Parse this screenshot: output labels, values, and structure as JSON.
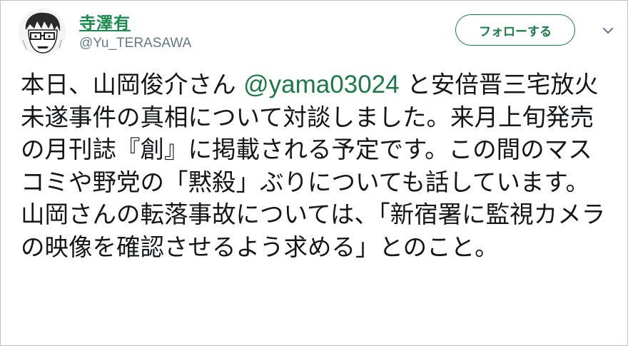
{
  "user": {
    "display_name": "寺澤有",
    "handle": "@Yu_TERASAWA"
  },
  "actions": {
    "follow_label": "フォローする",
    "more_icon": "chevron-down-icon"
  },
  "tweet": {
    "text_before": "本日、山岡俊介さん ",
    "mention": "@yama03024",
    "text_after": " と安倍晋三宅放火未遂事件の真相について対談しました。来月上旬発売の月刊誌『創』に掲載される予定です。この間のマスコミや野党の「黙殺」ぶりについても話しています。山岡さんの転落事故については、「新宿署に監視カメラの映像を確認させるよう求める」とのこと。"
  },
  "colors": {
    "name": "#1b8a4e",
    "accent": "#1b7a48",
    "handle": "#657786",
    "text": "#14171a",
    "border": "#b9c0c7"
  }
}
